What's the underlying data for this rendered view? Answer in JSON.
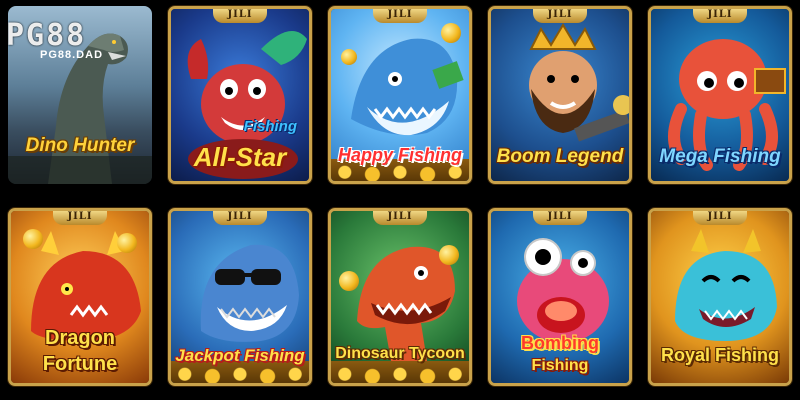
{
  "watermark": {
    "logo_text": "PG88",
    "sub_text": "PG88.DAD"
  },
  "colors": {
    "frame_gold": "#c9a24a",
    "title_red": "#e3261c",
    "title_blue": "#38a8ff",
    "title_yellow": "#ffe14a",
    "background": "#000000"
  },
  "games": [
    {
      "title": "Dino Hunter",
      "title_lines": [
        "Dino Hunter"
      ],
      "provider": "",
      "character": "dinosaur"
    },
    {
      "title": "All-Star Fishing",
      "title_lines": [
        "Fishing",
        "All-Star"
      ],
      "provider": "JILI",
      "character": "red-ogre"
    },
    {
      "title": "Happy Fishing",
      "title_lines": [
        "Happy Fishing"
      ],
      "provider": "JILI",
      "character": "shark"
    },
    {
      "title": "Boom Legend",
      "title_lines": [
        "Boom Legend"
      ],
      "provider": "JILI",
      "character": "pirate-king"
    },
    {
      "title": "Mega Fishing",
      "title_lines": [
        "Mega Fishing"
      ],
      "provider": "JILI",
      "character": "octopus"
    },
    {
      "title": "Dragon Fortune",
      "title_lines": [
        "Dragon",
        "Fortune"
      ],
      "provider": "JILI",
      "character": "dragon"
    },
    {
      "title": "Jackpot Fishing",
      "title_lines": [
        "Jackpot Fishing"
      ],
      "provider": "JILI",
      "character": "cool-shark"
    },
    {
      "title": "Dinosaur Tycoon",
      "title_lines": [
        "Dinosaur Tycoon"
      ],
      "provider": "JILI",
      "character": "t-rex"
    },
    {
      "title": "Bombing Fishing",
      "title_lines": [
        "Bombing",
        "Fishing"
      ],
      "provider": "JILI",
      "character": "pink-fish"
    },
    {
      "title": "Royal Fishing",
      "title_lines": [
        "Royal Fishing"
      ],
      "provider": "JILI",
      "character": "blue-dragon"
    }
  ]
}
